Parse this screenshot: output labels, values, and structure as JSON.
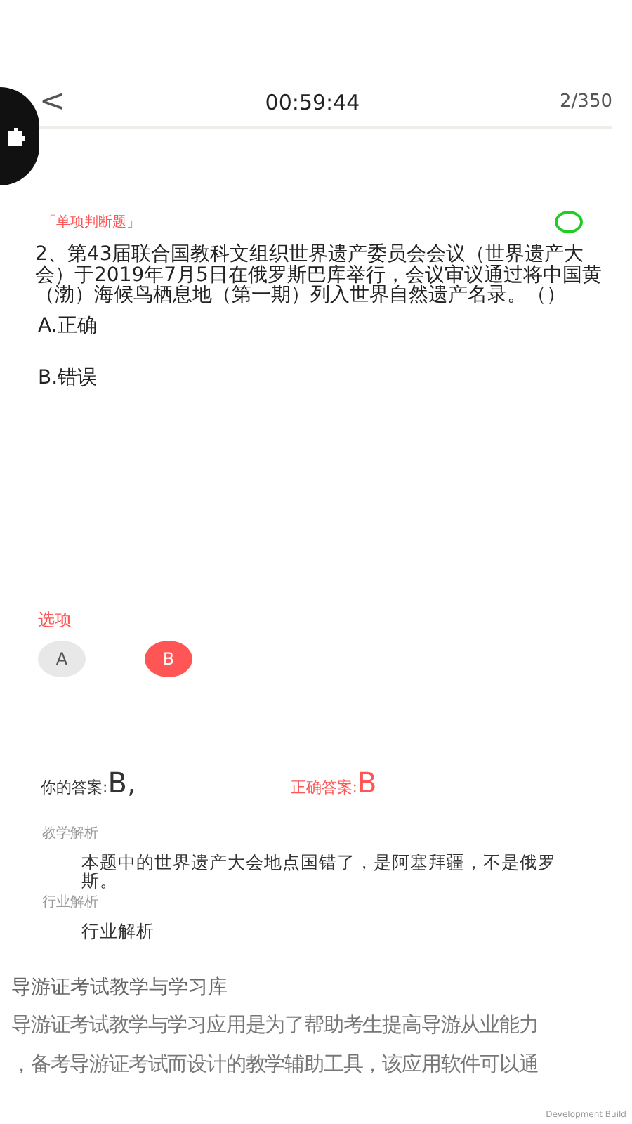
{
  "header": {
    "back": "<",
    "timer": "00:59:44",
    "progress": "2/350"
  },
  "question": {
    "type_label": "「单项判断题」",
    "marked": false,
    "text": "2、第43届联合国教科文组织世界遗产委员会会议（世界遗产大会）于2019年7月5日在俄罗斯巴库举行，会议审议通过将中国黄（渤）海候鸟栖息地（第一期）列入世界自然遗产名录。（）",
    "options": [
      {
        "text": "A.正确"
      },
      {
        "text": "B.错误"
      }
    ]
  },
  "choices": {
    "label": "选项",
    "items": [
      {
        "letter": "A",
        "selected": false
      },
      {
        "letter": "B",
        "selected": true
      }
    ]
  },
  "answers": {
    "yours_label": "你的答案:",
    "yours": "B,",
    "correct_label": "正确答案:",
    "correct": "B"
  },
  "analysis": [
    {
      "title": "教学解析",
      "body": "本题中的世界遗产大会地点国错了，是阿塞拜疆，不是俄罗斯。"
    },
    {
      "title": "行业解析",
      "body": "行业解析"
    }
  ],
  "caption": {
    "title": "导游证考试教学与学习库",
    "lines": [
      "导游证考试教学与学习应用是为了帮助考生提高导游从业能力",
      "，备考导游证考试而设计的教学辅助工具，该应用软件可以通"
    ]
  },
  "build_label": "Development Build"
}
